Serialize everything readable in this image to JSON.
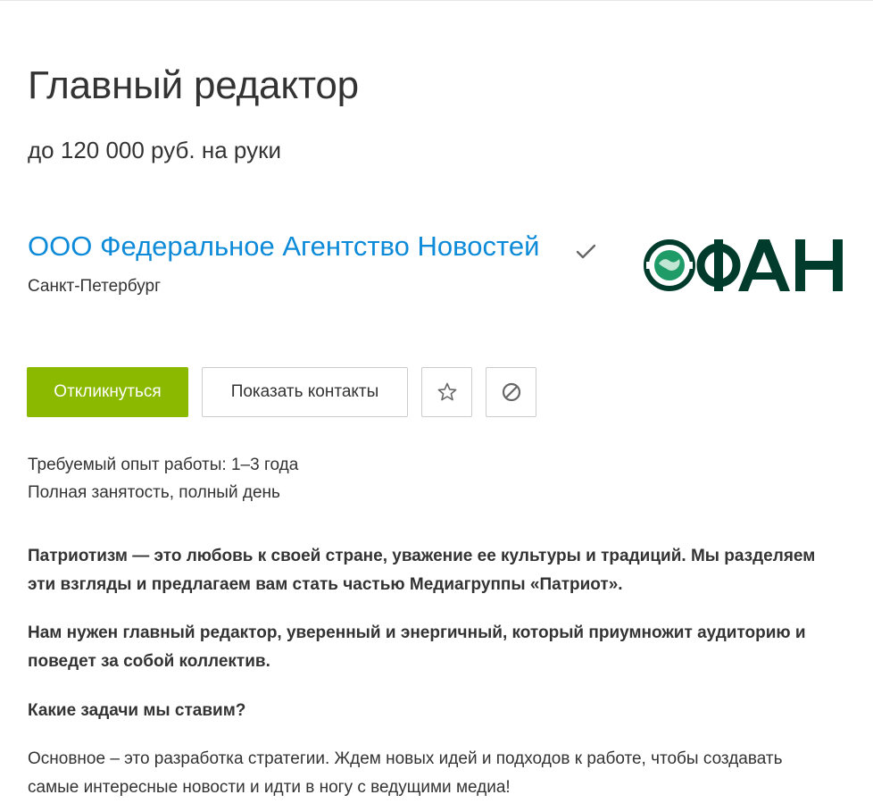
{
  "vacancy": {
    "title": "Главный редактор",
    "salary": "до 120 000 руб. на руки"
  },
  "company": {
    "name": "ООО Федеральное Агентство Новостей",
    "city": "Санкт-Петербург",
    "verified_icon": "check-icon",
    "logo_text": "ФАН",
    "logo_color": "#003b2c"
  },
  "actions": {
    "apply_label": "Откликнуться",
    "contacts_label": "Показать контакты",
    "favorite_icon": "star-icon",
    "hide_icon": "block-icon",
    "apply_color": "#8bb900"
  },
  "details": {
    "experience": "Требуемый опыт работы: 1–3 года",
    "employment": "Полная занятость, полный день"
  },
  "description": {
    "p1": "Патриотизм — это любовь к своей стране, уважение ее культуры и традиций. Мы разделяем эти взгляды и предлагаем вам стать частью Медиагруппы «Патриот».",
    "p2": "Нам нужен главный редактор, уверенный и энергичный, который приумножит аудиторию и поведет за собой коллектив.",
    "p3": "Какие задачи мы ставим?",
    "p4": "Основное – это разработка стратегии. Ждем новых идей и подходов к работе, чтобы создавать самые интересные новости и идти в ногу с ведущими медиа!"
  },
  "colors": {
    "link": "#0d8bd9",
    "text": "#333333"
  }
}
